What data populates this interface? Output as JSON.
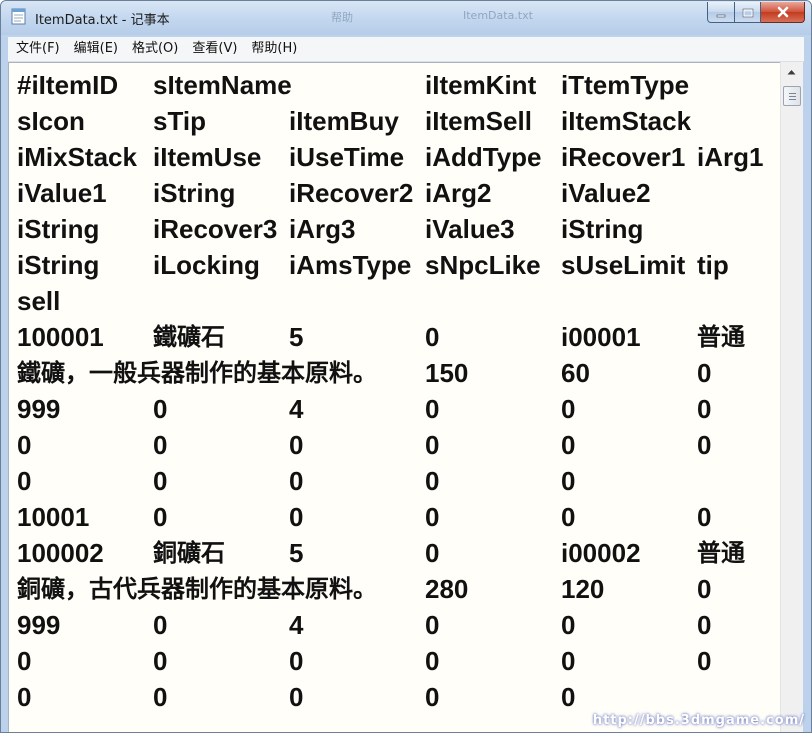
{
  "window": {
    "title": "ItemData.txt - 记事本",
    "background_title_fragments": [
      "ItemData.txt",
      "帮助",
      "ItemData.txt"
    ],
    "accent_color": "#bcd2ec",
    "close_color": "#c23b1d"
  },
  "menubar": {
    "items": [
      "文件(F)",
      "编辑(E)",
      "格式(O)",
      "查看(V)",
      "帮助(H)"
    ]
  },
  "editor": {
    "background": "#fffef8",
    "lines": [
      [
        "#iItemID",
        "sItemName",
        "",
        "iItemKint",
        "iTtemType",
        ""
      ],
      [
        "sIcon",
        "sTip",
        "iItemBuy",
        "iItemSell",
        "iItemStack",
        ""
      ],
      [
        "iMixStack",
        "iItemUse",
        "iUseTime",
        "iAddType",
        "iRecover1",
        "iArg1"
      ],
      [
        "iValue1",
        "iString",
        "iRecover2",
        "iArg2",
        "iValue2",
        ""
      ],
      [
        "iString",
        "iRecover3",
        "iArg3",
        "iValue3",
        "iString",
        ""
      ],
      [
        "iString",
        "iLocking",
        "iAmsType",
        "sNpcLike",
        "sUseLimit",
        "tip"
      ],
      [
        "sell",
        "",
        "",
        "",
        "",
        ""
      ],
      [
        "100001",
        "鐵礦石",
        "5",
        "0",
        "i00001",
        "普通"
      ],
      [
        "鐵礦，一般兵器制作的基本原料。",
        "",
        "",
        "150",
        "60",
        "0"
      ],
      [
        "999",
        "0",
        "4",
        "0",
        "0",
        "0"
      ],
      [
        "0",
        "0",
        "0",
        "0",
        "0",
        "0"
      ],
      [
        "0",
        "0",
        "0",
        "0",
        "0",
        ""
      ],
      [
        "10001",
        "0",
        "0",
        "0",
        "0",
        "0"
      ],
      [
        "100002",
        "銅礦石",
        "5",
        "0",
        "i00002",
        "普通"
      ],
      [
        "銅礦，古代兵器制作的基本原料。",
        "",
        "",
        "280",
        "120",
        "0"
      ],
      [
        "999",
        "0",
        "4",
        "0",
        "0",
        "0"
      ],
      [
        "0",
        "0",
        "0",
        "0",
        "0",
        "0"
      ],
      [
        "0",
        "0",
        "0",
        "0",
        "0",
        ""
      ]
    ]
  },
  "scrollbar": {
    "up_icon": "scroll-up-arrow",
    "position_fraction": 0.0
  },
  "watermark": "http://bbs.3dmgame.com/"
}
